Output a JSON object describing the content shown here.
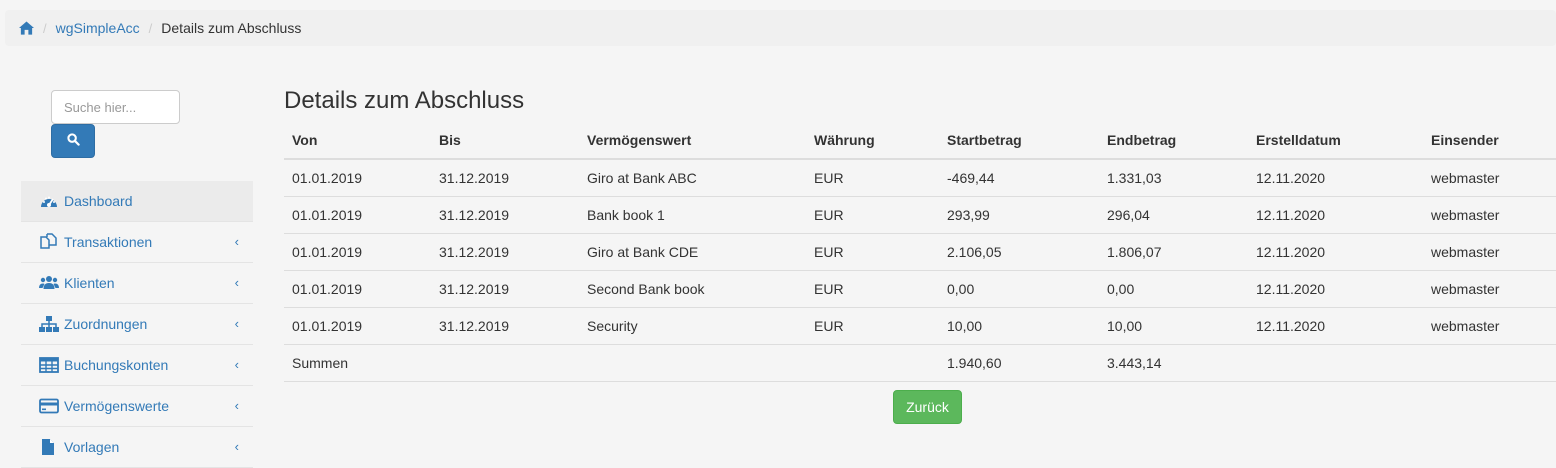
{
  "breadcrumb": {
    "home_icon": "home-icon",
    "app": "wgSimpleAcc",
    "current": "Details zum Abschluss"
  },
  "search": {
    "placeholder": "Suche hier...",
    "button_icon": "search-icon"
  },
  "sidebar": {
    "items": [
      {
        "label": "Dashboard",
        "icon": "dashboard-icon"
      },
      {
        "label": "Transaktionen",
        "icon": "copy-icon"
      },
      {
        "label": "Klienten",
        "icon": "users-icon"
      },
      {
        "label": "Zuordnungen",
        "icon": "sitemap-icon"
      },
      {
        "label": "Buchungskonten",
        "icon": "table-icon"
      },
      {
        "label": "Vermögenswerte",
        "icon": "credit-card-icon"
      },
      {
        "label": "Vorlagen",
        "icon": "file-icon"
      }
    ],
    "chevron": "‹"
  },
  "main": {
    "title": "Details zum Abschluss",
    "columns": [
      "Von",
      "Bis",
      "Vermögenswert",
      "Währung",
      "Startbetrag",
      "Endbetrag",
      "Erstelldatum",
      "Einsender"
    ],
    "rows": [
      [
        "01.01.2019",
        "31.12.2019",
        "Giro at Bank ABC",
        "EUR",
        "-469,44",
        "1.331,03",
        "12.11.2020",
        "webmaster"
      ],
      [
        "01.01.2019",
        "31.12.2019",
        "Bank book 1",
        "EUR",
        "293,99",
        "296,04",
        "12.11.2020",
        "webmaster"
      ],
      [
        "01.01.2019",
        "31.12.2019",
        "Giro at Bank CDE",
        "EUR",
        "2.106,05",
        "1.806,07",
        "12.11.2020",
        "webmaster"
      ],
      [
        "01.01.2019",
        "31.12.2019",
        "Second Bank book",
        "EUR",
        "0,00",
        "0,00",
        "12.11.2020",
        "webmaster"
      ],
      [
        "01.01.2019",
        "31.12.2019",
        "Security",
        "EUR",
        "10,00",
        "10,00",
        "12.11.2020",
        "webmaster"
      ]
    ],
    "totals": {
      "label": "Summen",
      "start": "1.940,60",
      "end": "3.443,14"
    },
    "back_button": "Zurück"
  },
  "colors": {
    "link": "#337ab7",
    "primary": "#337ab7",
    "success": "#5cb85c"
  }
}
